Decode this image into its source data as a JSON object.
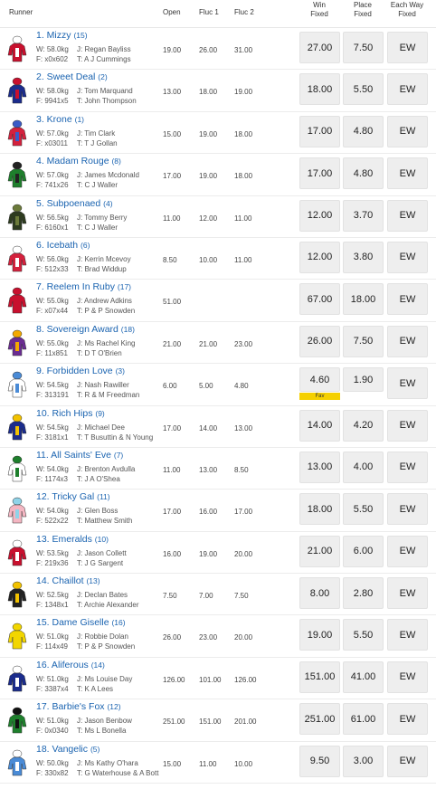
{
  "header": {
    "runner": "Runner",
    "open": "Open",
    "fluc1": "Fluc 1",
    "fluc2": "Fluc 2",
    "win_line1": "Win",
    "win_line2": "Fixed",
    "place_line1": "Place",
    "place_line2": "Fixed",
    "ew_line1": "Each Way",
    "ew_line2": "Fixed"
  },
  "runners": [
    {
      "name": "1. Mizzy",
      "barrier": "(15)",
      "weight": "W: 58.0kg",
      "jockey": "J: Regan Bayliss",
      "form": "F: x0x602",
      "trainer": "T: A J Cummings",
      "open": "19.00",
      "fluc1": "26.00",
      "fluc2": "31.00",
      "win": "27.00",
      "place": "7.50",
      "ew": "EW",
      "silk": [
        "#c8102e",
        "#ffffff"
      ]
    },
    {
      "name": "2. Sweet Deal",
      "barrier": "(2)",
      "weight": "W: 58.0kg",
      "jockey": "J: Tom Marquand",
      "form": "F: 9941x5",
      "trainer": "T: John Thompson",
      "open": "13.00",
      "fluc1": "18.00",
      "fluc2": "19.00",
      "win": "18.00",
      "place": "5.50",
      "ew": "EW",
      "silk": [
        "#1b2c8c",
        "#c8102e"
      ]
    },
    {
      "name": "3. Krone",
      "barrier": "(1)",
      "weight": "W: 57.0kg",
      "jockey": "J: Tim Clark",
      "form": "F: x03011",
      "trainer": "T: T J Gollan",
      "open": "15.00",
      "fluc1": "19.00",
      "fluc2": "18.00",
      "win": "17.00",
      "place": "4.80",
      "ew": "EW",
      "silk": [
        "#d4213d",
        "#3a5bc7"
      ]
    },
    {
      "name": "4. Madam Rouge",
      "barrier": "(8)",
      "weight": "W: 57.0kg",
      "jockey": "J: James Mcdonald",
      "form": "F: 741x26",
      "trainer": "T: C J Waller",
      "open": "17.00",
      "fluc1": "19.00",
      "fluc2": "18.00",
      "win": "17.00",
      "place": "4.80",
      "ew": "EW",
      "silk": [
        "#1e7f2c",
        "#222222"
      ]
    },
    {
      "name": "5. Subpoenaed",
      "barrier": "(4)",
      "weight": "W: 56.5kg",
      "jockey": "J: Tommy Berry",
      "form": "F: 6160x1",
      "trainer": "T: C J Waller",
      "open": "11.00",
      "fluc1": "12.00",
      "fluc2": "11.00",
      "win": "12.00",
      "place": "3.70",
      "ew": "EW",
      "silk": [
        "#2d3b1f",
        "#6b7a3a"
      ]
    },
    {
      "name": "6. Icebath",
      "barrier": "(6)",
      "weight": "W: 56.0kg",
      "jockey": "J: Kerrin Mcevoy",
      "form": "F: 512x33",
      "trainer": "T: Brad Widdup",
      "open": "8.50",
      "fluc1": "10.00",
      "fluc2": "11.00",
      "win": "12.00",
      "place": "3.80",
      "ew": "EW",
      "silk": [
        "#d4213d",
        "#ffffff"
      ]
    },
    {
      "name": "7. Reelem In Ruby",
      "barrier": "(17)",
      "weight": "W: 55.0kg",
      "jockey": "J: Andrew Adkins",
      "form": "F: x07x44",
      "trainer": "T: P & P Snowden",
      "open": "51.00",
      "fluc1": "",
      "fluc2": "",
      "win": "67.00",
      "place": "18.00",
      "ew": "EW",
      "silk": [
        "#c8102e",
        "#c8102e"
      ]
    },
    {
      "name": "8. Sovereign Award",
      "barrier": "(18)",
      "weight": "W: 55.0kg",
      "jockey": "J: Ms Rachel King",
      "form": "F: 11x851",
      "trainer": "T: D T O'Brien",
      "open": "21.00",
      "fluc1": "21.00",
      "fluc2": "23.00",
      "win": "26.00",
      "place": "7.50",
      "ew": "EW",
      "silk": [
        "#6a2c91",
        "#f2a900"
      ]
    },
    {
      "name": "9. Forbidden Love",
      "barrier": "(3)",
      "weight": "W: 54.5kg",
      "jockey": "J: Nash Rawiller",
      "form": "F: 313191",
      "trainer": "T: R & M Freedman",
      "open": "6.00",
      "fluc1": "5.00",
      "fluc2": "4.80",
      "win": "4.60",
      "place": "1.90",
      "ew": "EW",
      "fav": "Fav",
      "silk": [
        "#ffffff",
        "#4a8bd6"
      ]
    },
    {
      "name": "10. Rich Hips",
      "barrier": "(9)",
      "weight": "W: 54.5kg",
      "jockey": "J: Michael Dee",
      "form": "F: 3181x1",
      "trainer": "T: T Busuttin & N Young",
      "open": "17.00",
      "fluc1": "14.00",
      "fluc2": "13.00",
      "win": "14.00",
      "place": "4.20",
      "ew": "EW",
      "silk": [
        "#1b2c8c",
        "#f2c200"
      ]
    },
    {
      "name": "11. All Saints' Eve",
      "barrier": "(7)",
      "weight": "W: 54.0kg",
      "jockey": "J: Brenton Avdulla",
      "form": "F: 1174x3",
      "trainer": "T: J A O'Shea",
      "open": "11.00",
      "fluc1": "13.00",
      "fluc2": "8.50",
      "win": "13.00",
      "place": "4.00",
      "ew": "EW",
      "silk": [
        "#ffffff",
        "#1e7f2c"
      ]
    },
    {
      "name": "12. Tricky Gal",
      "barrier": "(11)",
      "weight": "W: 54.0kg",
      "jockey": "J: Glen Boss",
      "form": "F: 522x22",
      "trainer": "T: Matthew Smith",
      "open": "17.00",
      "fluc1": "16.00",
      "fluc2": "17.00",
      "win": "18.00",
      "place": "5.50",
      "ew": "EW",
      "silk": [
        "#f4b6c2",
        "#8fd3e8"
      ]
    },
    {
      "name": "13. Emeralds",
      "barrier": "(10)",
      "weight": "W: 53.5kg",
      "jockey": "J: Jason Collett",
      "form": "F: 219x36",
      "trainer": "T: J G Sargent",
      "open": "16.00",
      "fluc1": "19.00",
      "fluc2": "20.00",
      "win": "21.00",
      "place": "6.00",
      "ew": "EW",
      "silk": [
        "#c8102e",
        "#ffffff"
      ]
    },
    {
      "name": "14. Chaillot",
      "barrier": "(13)",
      "weight": "W: 52.5kg",
      "jockey": "J: Declan Bates",
      "form": "F: 1348x1",
      "trainer": "T: Archie Alexander",
      "open": "7.50",
      "fluc1": "7.00",
      "fluc2": "7.50",
      "win": "8.00",
      "place": "2.80",
      "ew": "EW",
      "silk": [
        "#222222",
        "#f2c200"
      ]
    },
    {
      "name": "15. Dame Giselle",
      "barrier": "(16)",
      "weight": "W: 51.0kg",
      "jockey": "J: Robbie Dolan",
      "form": "F: 114x49",
      "trainer": "T: P & P Snowden",
      "open": "26.00",
      "fluc1": "23.00",
      "fluc2": "20.00",
      "win": "19.00",
      "place": "5.50",
      "ew": "EW",
      "silk": [
        "#f2d600",
        "#f2d600"
      ]
    },
    {
      "name": "16. Aliferous",
      "barrier": "(14)",
      "weight": "W: 51.0kg",
      "jockey": "J: Ms Louise Day",
      "form": "F: 3387x4",
      "trainer": "T: K A Lees",
      "open": "126.00",
      "fluc1": "101.00",
      "fluc2": "126.00",
      "win": "151.00",
      "place": "41.00",
      "ew": "EW",
      "silk": [
        "#1b2c8c",
        "#ffffff"
      ]
    },
    {
      "name": "17. Barbie's Fox",
      "barrier": "(12)",
      "weight": "W: 51.0kg",
      "jockey": "J: Jason Benbow",
      "form": "F: 0x0340",
      "trainer": "T: Ms L Bonella",
      "open": "251.00",
      "fluc1": "151.00",
      "fluc2": "201.00",
      "win": "251.00",
      "place": "61.00",
      "ew": "EW",
      "silk": [
        "#1e7f2c",
        "#111111"
      ]
    },
    {
      "name": "18. Vangelic",
      "barrier": "(5)",
      "weight": "W: 50.0kg",
      "jockey": "J: Ms Kathy O'hara",
      "form": "F: 330x82",
      "trainer": "T: G Waterhouse & A Bott",
      "open": "15.00",
      "fluc1": "11.00",
      "fluc2": "10.00",
      "win": "9.50",
      "place": "3.00",
      "ew": "EW",
      "silk": [
        "#4a8bd6",
        "#ffffff"
      ]
    }
  ]
}
